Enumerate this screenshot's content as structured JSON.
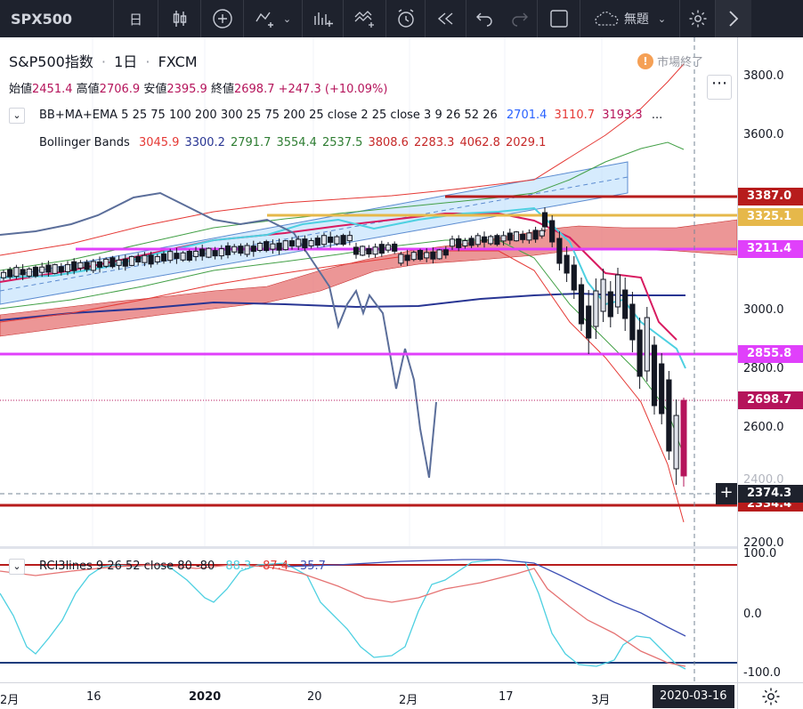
{
  "toolbar": {
    "symbol": "SPX500",
    "interval": "日",
    "layout_name": "無題"
  },
  "header": {
    "title": "S&P500指数",
    "interval": "1日",
    "source": "FXCM",
    "dot": "·",
    "status_text": "市場終了"
  },
  "ohlc": {
    "open_label": "始値",
    "open": "2451.4",
    "high_label": "高値",
    "high": "2706.9",
    "low_label": "安値",
    "low": "2395.9",
    "close_label": "終値",
    "close": "2698.7",
    "change": "+247.3 (+10.09%)"
  },
  "indicators": {
    "bb_ma_ema": {
      "name": "BB+MA+EMA 5 25 75 100 200 300 25 75 200 25 close 2 25 close 3 9 26 52 26",
      "v1": "2701.4",
      "v2": "3110.7",
      "v3": "3193.3",
      "more": "..."
    },
    "bollinger": {
      "name": "Bollinger Bands",
      "values": [
        {
          "text": "3045.9",
          "color": "#e53935"
        },
        {
          "text": "3300.2",
          "color": "#283593"
        },
        {
          "text": "2791.7",
          "color": "#2e7d32"
        },
        {
          "text": "3554.4",
          "color": "#2e7d32"
        },
        {
          "text": "2537.5",
          "color": "#2e7d32"
        },
        {
          "text": "3808.6",
          "color": "#c62828"
        },
        {
          "text": "2283.3",
          "color": "#c62828"
        },
        {
          "text": "4062.8",
          "color": "#c62828"
        },
        {
          "text": "2029.1",
          "color": "#c62828"
        }
      ]
    },
    "rci": {
      "name": "RCI3lines 9 26 52 close 80 -80",
      "v1": "88.3",
      "v2": "-87.4",
      "v3": "-35.7"
    }
  },
  "price_axis": {
    "labels": [
      "3800.0",
      "3600.0",
      "3000.0",
      "2800.0",
      "2600.0",
      "2200.0"
    ],
    "tags": [
      {
        "text": "3387.0",
        "color": "#b71c1c"
      },
      {
        "text": "3325.1",
        "color": "#e6b84a"
      },
      {
        "text": "3211.4",
        "color": "#e040fb"
      },
      {
        "text": "2855.8",
        "color": "#e040fb"
      },
      {
        "text": "2698.7",
        "color": "#b5145b"
      },
      {
        "text": "2374.3",
        "color": "#1e222d"
      },
      {
        "text": "2334.4",
        "color": "#b71c1c"
      }
    ],
    "partial_label": "2400.0",
    "osc_labels": [
      "100.0",
      "0.0",
      "-100.0"
    ]
  },
  "time_axis": {
    "labels": [
      "2月",
      "16",
      "2020",
      "20",
      "2月",
      "17",
      "3月"
    ],
    "crosshair_date": "2020-03-16"
  },
  "colors": {
    "up": "#e0e3eb",
    "down": "#131722",
    "accent_red": "#b71c1c",
    "accent_magenta": "#e040fb",
    "accent_gold": "#e6b84a"
  }
}
